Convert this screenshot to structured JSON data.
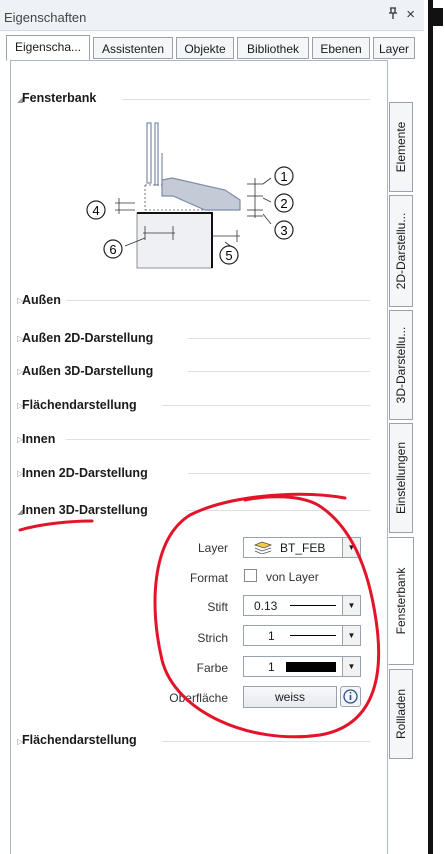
{
  "window": {
    "title": "Eigenschaften",
    "pin_glyph": "\u0004",
    "close_glyph": "×"
  },
  "top_tabs": [
    "Eigenscha...",
    "Assistenten",
    "Objekte",
    "Bibliothek",
    "Ebenen",
    "Layer"
  ],
  "side_tabs": [
    "Elemente",
    "2D-Darstellu...",
    "3D-Darstellu...",
    "Einstellungen",
    "Fensterbank",
    "Rollladen"
  ],
  "sections": {
    "fensterbank": "Fensterbank",
    "aussen": "Außen",
    "aussen_2d": "Außen 2D-Darstellung",
    "aussen_3d": "Außen 3D-Darstellung",
    "flaechen_1": "Flächendarstellung",
    "innen": "Innen",
    "innen_2d": "Innen 2D-Darstellung",
    "innen_3d": "Innen 3D-Darstellung",
    "flaechen_2": "Flächendarstellung"
  },
  "diagram_numbers": [
    "1",
    "2",
    "3",
    "4",
    "5",
    "6"
  ],
  "properties": {
    "layer_label": "Layer",
    "layer_value": "BT_FEB",
    "format_label": "Format",
    "format_value": "von Layer",
    "format_checked": false,
    "stift_label": "Stift",
    "stift_value": "0.13",
    "strich_label": "Strich",
    "strich_value": "1",
    "farbe_label": "Farbe",
    "farbe_value": "1",
    "oberflaeche_label": "Oberfläche",
    "oberflaeche_value": "weiss"
  },
  "colors": {
    "annotation_red": "#e3142a",
    "farbe_swatch": "#000000"
  }
}
